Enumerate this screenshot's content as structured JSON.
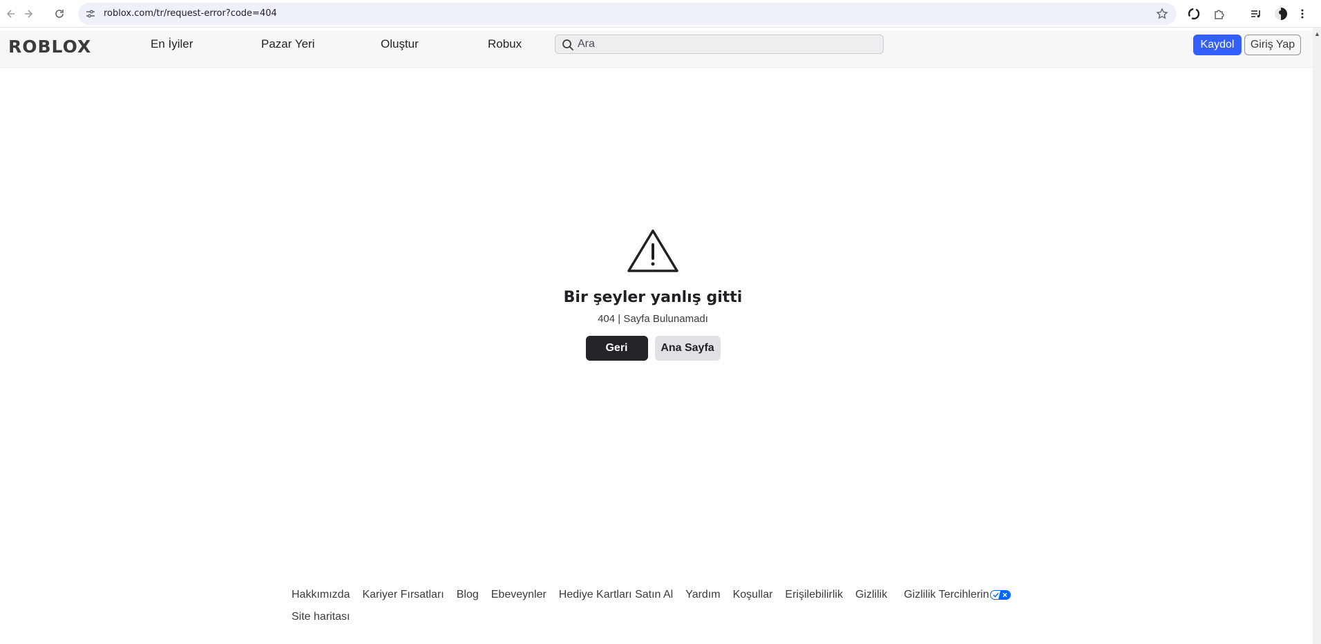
{
  "browser": {
    "url": "roblox.com/tr/request-error?code=404"
  },
  "header": {
    "logo": "ROBLOX",
    "nav": [
      "En İyiler",
      "Pazar Yeri",
      "Oluştur",
      "Robux"
    ],
    "search_placeholder": "Ara",
    "signup_label": "Kaydol",
    "login_label": "Giriş Yap"
  },
  "error": {
    "title": "Bir şeyler yanlış gitti",
    "subtitle": "404 | Sayfa Bulunamadı",
    "back_label": "Geri",
    "home_label": "Ana Sayfa"
  },
  "footer": {
    "links": [
      "Hakkımızda",
      "Kariyer Fırsatları",
      "Blog",
      "Ebeveynler",
      "Hediye Kartları Satın Al",
      "Yardım",
      "Koşullar",
      "Erişilebilirlik",
      "Gizlilik",
      "Gizlilik Tercihlerin"
    ],
    "sitemap": "Site haritası"
  },
  "colors": {
    "brand_blue": "#335fff",
    "dark_button": "#222428",
    "light_button": "#e0e1e4"
  }
}
